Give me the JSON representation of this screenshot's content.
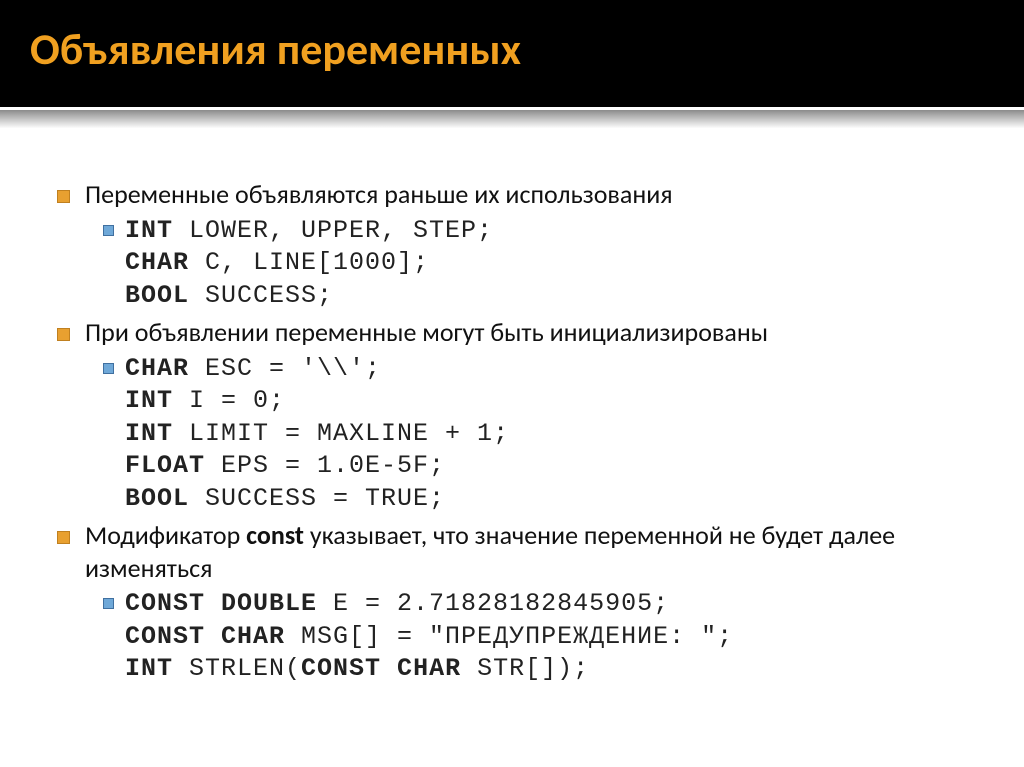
{
  "title": "Объявления переменных",
  "bullets": [
    {
      "text": "Переменные объявляются раньше их использования",
      "code": [
        {
          "bold": "int",
          "rest": " lower, upper, step;"
        },
        {
          "bold": "char",
          "rest": " c, line[1000];"
        },
        {
          "bold": "bool",
          "rest": " success;"
        }
      ]
    },
    {
      "text": "При объявлении переменные могут быть инициализированы",
      "code": [
        {
          "bold": "char",
          "rest": " esc = '\\\\';"
        },
        {
          "bold": "int",
          "rest": " i = 0;"
        },
        {
          "bold": "int",
          "rest": " limit = MAXLINE + 1;"
        },
        {
          "bold": "float",
          "rest": " eps = 1.0e-5f;"
        },
        {
          "bold": "bool",
          "rest": " success = true;"
        }
      ]
    },
    {
      "textParts": [
        "Модификатор ",
        "const",
        " указывает, что значение переменной не будет далее изменяться"
      ],
      "code": [
        {
          "bold": "const double",
          "rest": " e = 2.71828182845905;"
        },
        {
          "bold": "const char",
          "rest": " msg[] = \"предупреждение: \";"
        },
        {
          "bold": "int",
          "rest": " strlen(",
          "bold2": "const char",
          "rest2": " str[]);"
        }
      ]
    }
  ]
}
